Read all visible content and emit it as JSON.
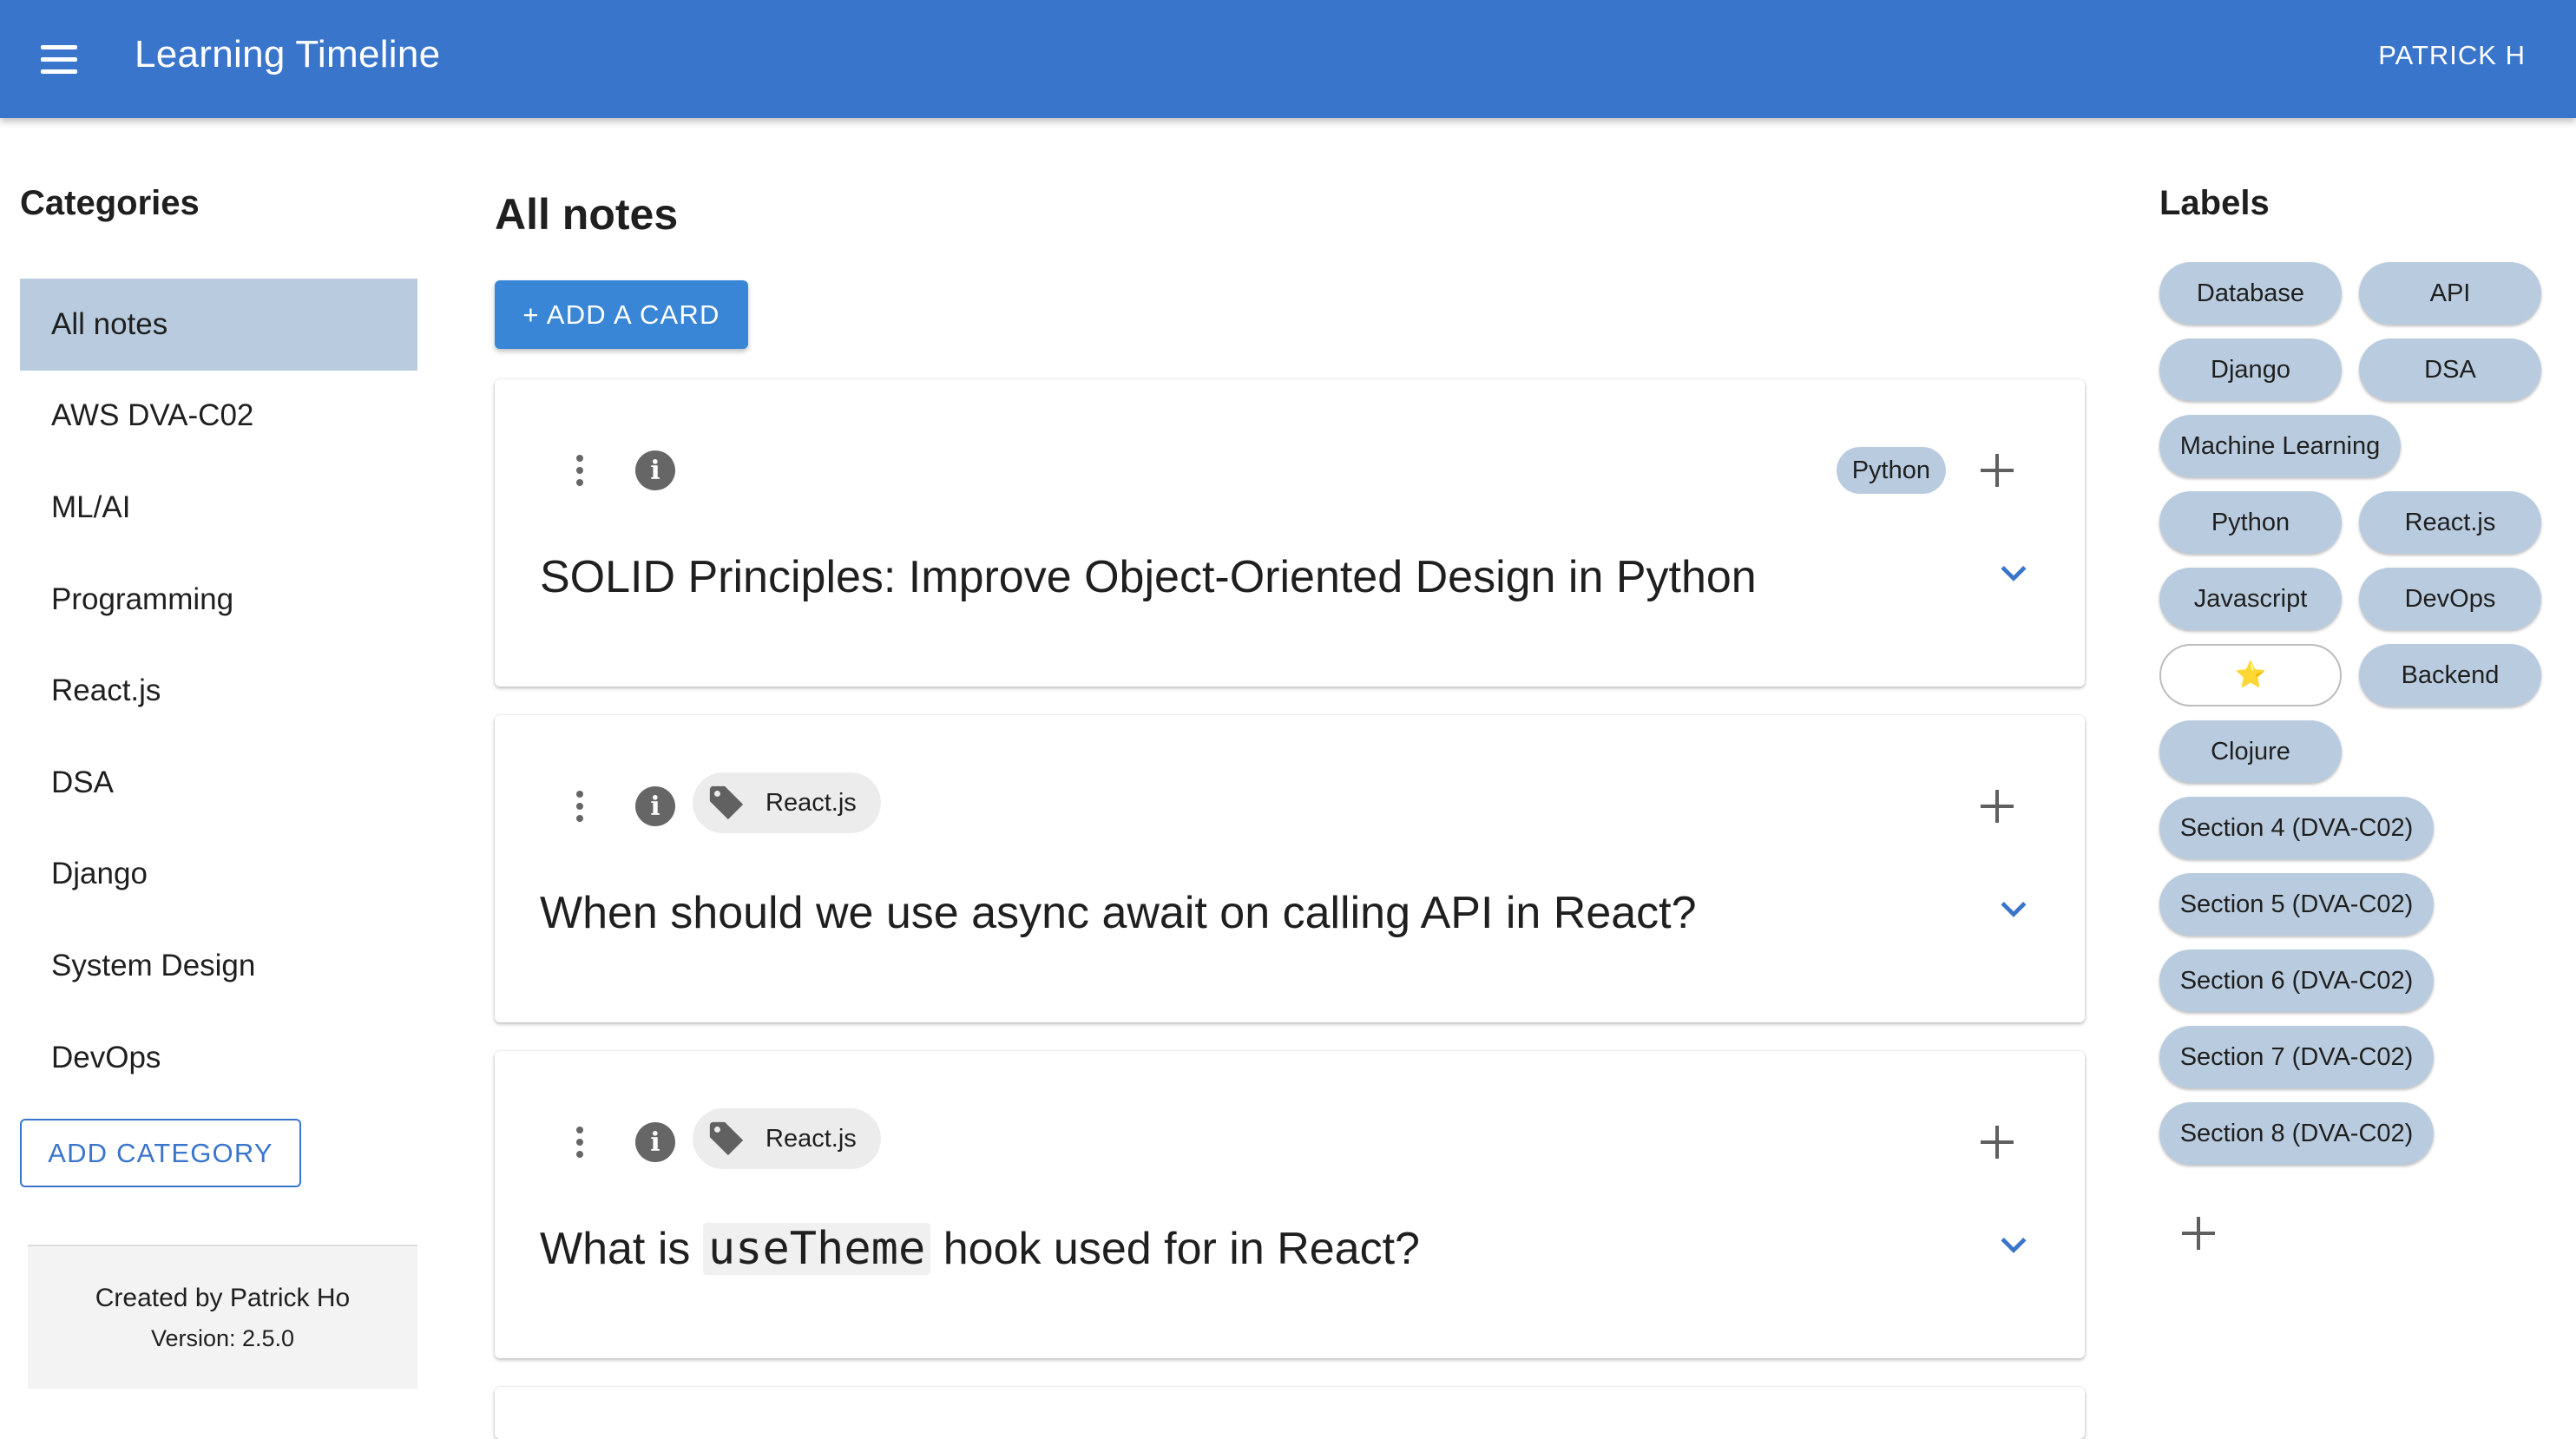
{
  "app": {
    "title": "Learning Timeline",
    "user": "PATRICK H",
    "menu_icon": "menu-icon"
  },
  "sidebar": {
    "heading": "Categories",
    "items": [
      {
        "label": "All notes",
        "active": true
      },
      {
        "label": "AWS DVA-C02"
      },
      {
        "label": "ML/AI"
      },
      {
        "label": "Programming"
      },
      {
        "label": "React.js"
      },
      {
        "label": "DSA"
      },
      {
        "label": "Django"
      },
      {
        "label": "System Design"
      },
      {
        "label": "DevOps"
      }
    ],
    "add_button": "ADD CATEGORY",
    "footer": {
      "created": "Created by Patrick Ho",
      "version": "Version: 2.5.0"
    }
  },
  "main": {
    "heading": "All notes",
    "add_card": "+ ADD A CARD",
    "cards": [
      {
        "title": "SOLID Principles: Improve Object-Oriented Design in Python",
        "chip": "Python"
      },
      {
        "title_before": "When should we use async await on calling API in React?",
        "tag": "React.js"
      },
      {
        "title_before": "What is ",
        "title_code": "useTheme",
        "title_after": " hook used for in React?",
        "tag": "React.js"
      }
    ]
  },
  "labels": {
    "heading": "Labels",
    "items": [
      "Database",
      "API",
      "Django",
      "DSA",
      "Machine Learning",
      "Python",
      "React.js",
      "Javascript",
      "DevOps",
      "⭐",
      "Backend",
      "Clojure",
      "Section 4 (DVA-C02)",
      "Section 5 (DVA-C02)",
      "Section 6 (DVA-C02)",
      "Section 7 (DVA-C02)",
      "Section 8 (DVA-C02)"
    ]
  },
  "colors": {
    "appbar": "#3a75cc",
    "accent": "#3a86d6",
    "chip": "#b9ccdf",
    "selected": "#b9ccdf"
  }
}
